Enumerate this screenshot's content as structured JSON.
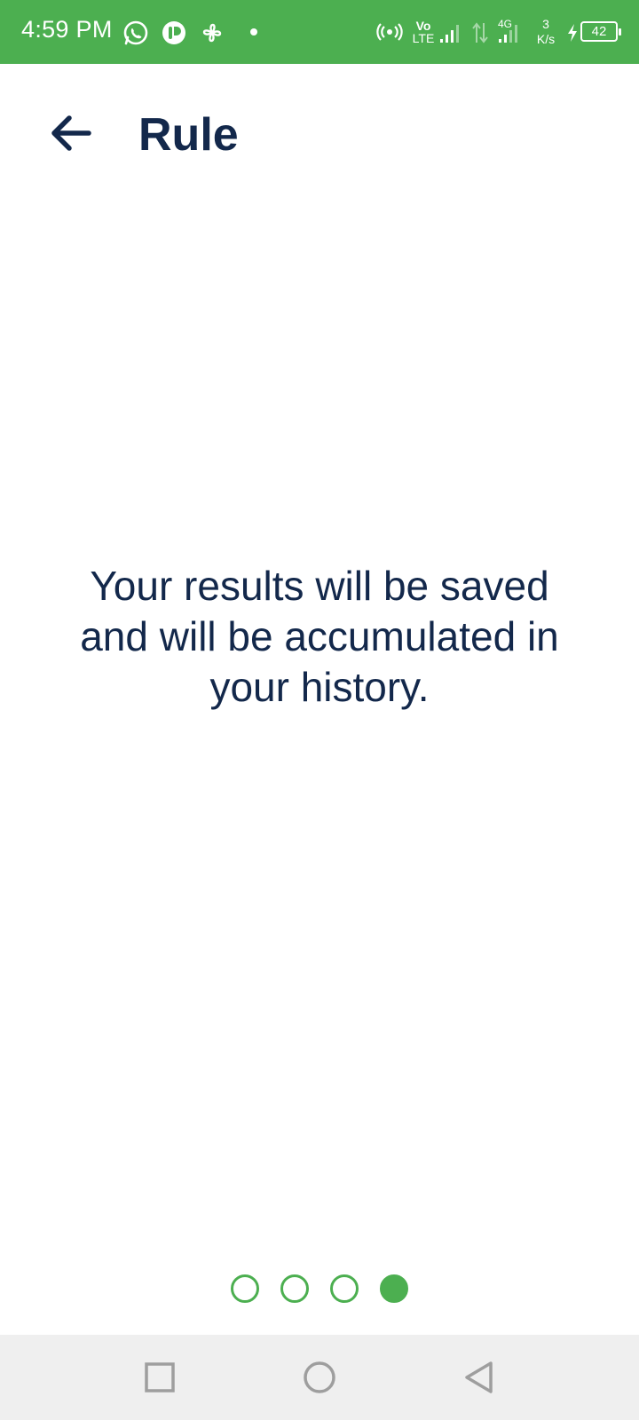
{
  "status_bar": {
    "time": "4:59 PM",
    "icons": [
      "whatsapp-icon",
      "app-notification-icon",
      "pinwheel-icon",
      "dot-icon",
      "hotspot-icon",
      "volte-icon",
      "signal-icon",
      "data-arrows-icon",
      "signal-4g-icon",
      "charging-icon"
    ],
    "volte_label_top": "Vo",
    "volte_label_bottom": "LTE",
    "network_type": "4G",
    "speed_value": "3",
    "speed_unit": "K/s",
    "battery_level": "42",
    "background_color": "#4CAF50"
  },
  "header": {
    "back_icon": "arrow-left-icon",
    "title": "Rule"
  },
  "content": {
    "message": "Your results will be saved and will be accumulated in your history."
  },
  "pager": {
    "total": 4,
    "active_index": 3,
    "accent_color": "#4CAF50"
  },
  "nav_bar": {
    "buttons": [
      "recents-square-icon",
      "home-circle-icon",
      "back-triangle-icon"
    ]
  },
  "colors": {
    "text_primary": "#13284b",
    "accent": "#4CAF50",
    "nav_background": "#efefef"
  }
}
